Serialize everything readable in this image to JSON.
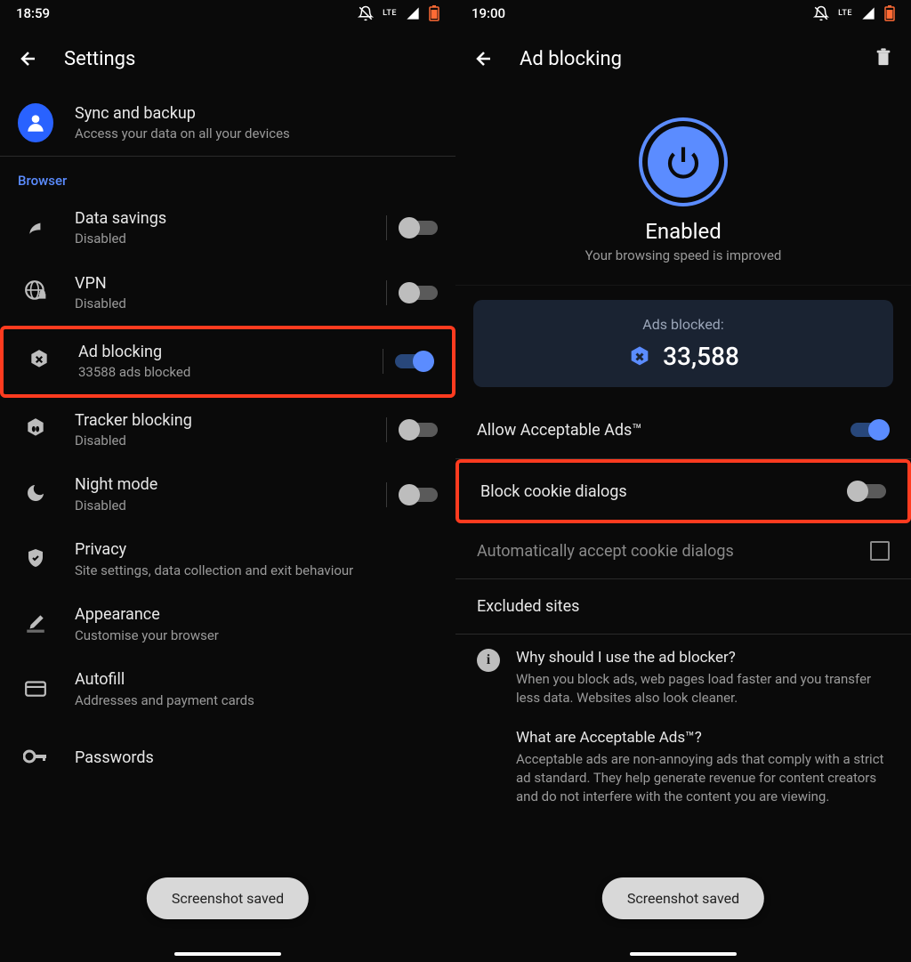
{
  "left": {
    "statusTime": "18:59",
    "title": "Settings",
    "sync": {
      "title": "Sync and backup",
      "subtitle": "Access your data on all your devices"
    },
    "sectionBrowser": "Browser",
    "dataSavings": {
      "title": "Data savings",
      "subtitle": "Disabled"
    },
    "vpn": {
      "title": "VPN",
      "subtitle": "Disabled"
    },
    "adBlocking": {
      "title": "Ad blocking",
      "subtitle": "33588 ads blocked"
    },
    "tracker": {
      "title": "Tracker blocking",
      "subtitle": "Disabled"
    },
    "nightMode": {
      "title": "Night mode",
      "subtitle": "Disabled"
    },
    "privacy": {
      "title": "Privacy",
      "subtitle": "Site settings, data collection and exit behaviour"
    },
    "appearance": {
      "title": "Appearance",
      "subtitle": "Customise your browser"
    },
    "autofill": {
      "title": "Autofill",
      "subtitle": "Addresses and payment cards"
    },
    "passwords": {
      "title": "Passwords"
    },
    "toast": "Screenshot saved"
  },
  "right": {
    "statusTime": "19:00",
    "title": "Ad blocking",
    "heroTitle": "Enabled",
    "heroSub": "Your browsing speed is improved",
    "statsLabel": "Ads blocked:",
    "statsValue": "33,588",
    "allowAds": "Allow Acceptable Ads™",
    "blockCookie": "Block cookie dialogs",
    "autoAccept": "Automatically accept cookie dialogs",
    "excluded": "Excluded sites",
    "info1Title": "Why should I use the ad blocker?",
    "info1Body": "When you block ads, web pages load faster and you transfer less data. Websites also look cleaner.",
    "info2Title": "What are Acceptable Ads™?",
    "info2Body": "Acceptable ads are non-annoying ads that comply with a strict ad standard. They help generate revenue for content creators and do not interfere with the content you are viewing.",
    "toast": "Screenshot saved"
  },
  "statusLte": "LTE"
}
